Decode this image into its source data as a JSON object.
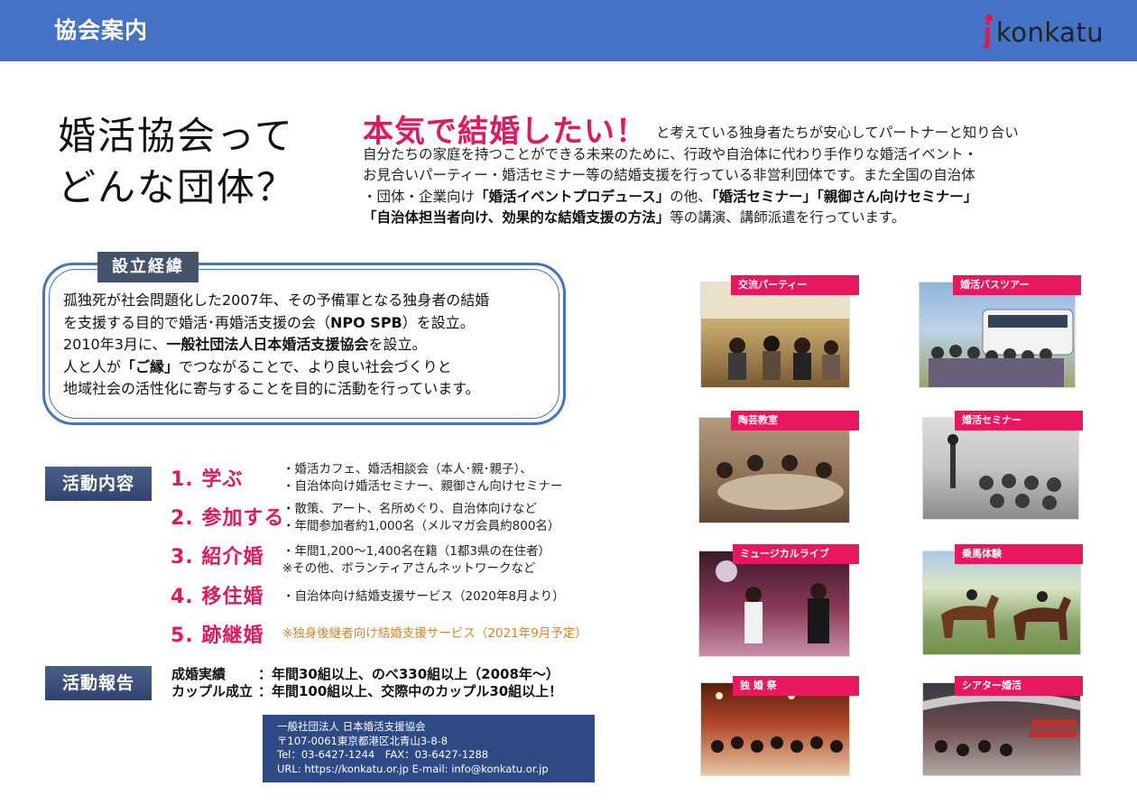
{
  "header": {
    "title": "協会案内",
    "logo_text": "konkatu"
  },
  "headline": {
    "line1": "婚活協会って",
    "line2": "どんな団体？"
  },
  "intro": {
    "strong": "本気で結婚したい！",
    "line1": "と考えている独身者たちが安心してパートナーと知り合い",
    "line2": "自分たちの家庭を持つことができる未来のために、行政や自治体に代わり手作りな婚活イベント・",
    "line3": "お見合いパーティー・婚活セミナー等の結婚支援を行っている非営利団体です。また全国の自治体",
    "line4a": "・団体・企業向け",
    "line4b": "「婚活イベントプロデュース」",
    "line4c": "の他、",
    "line4d": "「婚活セミナー」「親御さん向けセミナー」",
    "line5a": "「自治体担当者向け、効果的な結婚支援の方法」",
    "line5b": "等の講演、講師派遣を行っています。"
  },
  "origin": {
    "label": "設立経緯",
    "l1": "孤独死が社会問題化した2007年、その予備軍となる独身者の結婚",
    "l2a": "を支援する目的で婚活･再婚活支援の会（",
    "l2b": "NPO SPB",
    "l2c": "）を設立。",
    "l3a": "2010年3月に、",
    "l3b": "一般社団法人日本婚活支援協会",
    "l3c": "を設立。",
    "l4a": "人と人が",
    "l4b": "「ご縁」",
    "l4c": "でつながることで、より良い社会づくりと",
    "l5": "地域社会の活性化に寄与することを目的に活動を行っています。"
  },
  "activities": {
    "label": "活動内容",
    "items": [
      {
        "title": "1. 学ぶ",
        "d1": "・婚活カフェ、婚活相談会（本人･親･親子）、",
        "d2": "・自治体向け婚活セミナー、親御さん向けセミナー"
      },
      {
        "title": "2. 参加する",
        "d1": "・散策、アート、名所めぐり、自治体向けなど",
        "d2": "・年間参加者約1,000名（メルマガ会員約800名）"
      },
      {
        "title": "3. 紹介婚",
        "d1": "・年間1,200～1,400名在籍（1都3県の在住者）",
        "d2": "※その他、ボランティアさんネットワークなど"
      },
      {
        "title": "4. 移住婚",
        "d1": "・自治体向け結婚支援サービス（2020年8月より）",
        "d2": ""
      },
      {
        "title": "5. 跡継婚",
        "d1": "※独身後継者向け結婚支援サービス（2021年9月予定）",
        "d2": ""
      }
    ]
  },
  "report": {
    "label": "活動報告",
    "k1": "成婚実績",
    "v1": "：年間30組以上、のべ330組以上（2008年～）",
    "k2": "カップル成立",
    "v2": "：年間100組以上、交際中のカップル30組以上！"
  },
  "contact": {
    "l1": "一般社団法人 日本婚活支援協会",
    "l2": "〒107-0061東京都港区北青山3-8-8",
    "l3": "Tel：03-6427-1244　FAX：03-6427-1288",
    "l4": "URL: https://konkatu.or.jp  E-mail: info@konkatu.or.jp"
  },
  "photos": [
    {
      "label": "交流パーティー"
    },
    {
      "label": "婚活バスツアー"
    },
    {
      "label": "陶芸教室"
    },
    {
      "label": "婚活セミナー"
    },
    {
      "label": "ミュージカルライブ"
    },
    {
      "label": "乗馬体験"
    },
    {
      "label": "独 婚 祭"
    },
    {
      "label": "シアター婚活"
    }
  ],
  "colors": {
    "header": "#4472c4",
    "accent": "#e0185e",
    "navy": "#2e4a84"
  }
}
